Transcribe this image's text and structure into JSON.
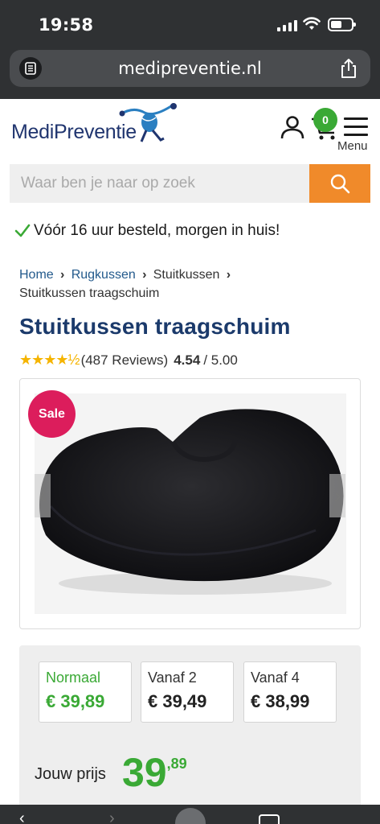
{
  "status_bar": {
    "time": "19:58"
  },
  "browser": {
    "url": "medipreventie.nl"
  },
  "site": {
    "logo_text": "MediPreventie",
    "cart_count": "0",
    "menu_label": "Menu"
  },
  "search": {
    "placeholder": "Waar ben je naar op zoek"
  },
  "usp": {
    "text": "Vóór 16 uur besteld, morgen in huis!"
  },
  "breadcrumb": {
    "items": [
      "Home",
      "Rugkussen",
      "Stuitkussen"
    ],
    "current": "Stuitkussen traagschuim"
  },
  "product": {
    "title": "Stuitkussen traagschuim",
    "rating_stars": 4.54,
    "reviews": "(487 Reviews)",
    "rating_value": "4.54",
    "rating_max": "/ 5.00",
    "sale_badge": "Sale",
    "image_alt": "Zwart stuitkussen van traagschuim"
  },
  "pricing": {
    "tiers": [
      {
        "label": "Normaal",
        "price": "€ 39,89",
        "active": true
      },
      {
        "label": "Vanaf 2",
        "price": "€ 39,49",
        "active": false
      },
      {
        "label": "Vanaf 4",
        "price": "€ 38,99",
        "active": false
      }
    ],
    "your_price_label": "Jouw prijs",
    "your_price_whole": "39",
    "your_price_cents": ",89"
  },
  "colors": {
    "brand_navy": "#1b3a6b",
    "accent_orange": "#f08a2a",
    "accent_green": "#3aa935",
    "sale_pink": "#dc1d5c"
  }
}
